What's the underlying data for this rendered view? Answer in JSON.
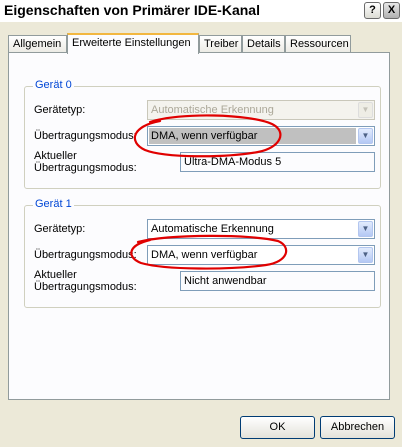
{
  "window": {
    "title": "Eigenschaften von Primärer IDE-Kanal",
    "help_label": "?",
    "close_label": "X"
  },
  "tabs": [
    {
      "label": "Allgemein"
    },
    {
      "label": "Erweiterte Einstellungen",
      "active": true
    },
    {
      "label": "Treiber"
    },
    {
      "label": "Details"
    },
    {
      "label": "Ressourcen"
    }
  ],
  "device0": {
    "legend": "Gerät 0",
    "type_label": "Gerätetyp:",
    "type_value": "Automatische Erkennung",
    "mode_label": "Übertragungsmodus:",
    "mode_value": "DMA, wenn verfügbar",
    "current_label_line1": "Aktueller",
    "current_label_line2": "Übertragungsmodus:",
    "current_value": "Ultra-DMA-Modus 5"
  },
  "device1": {
    "legend": "Gerät 1",
    "type_label": "Gerätetyp:",
    "type_value": "Automatische Erkennung",
    "mode_label": "Übertragungsmodus:",
    "mode_value": "DMA, wenn verfügbar",
    "current_label_line1": "Aktueller",
    "current_label_line2": "Übertragungsmodus:",
    "current_value": "Nicht anwendbar"
  },
  "buttons": {
    "ok": "OK",
    "cancel": "Abbrechen"
  },
  "colors": {
    "dialog_bg": "#ece9d8",
    "group_legend": "#0046d5",
    "annotation": "#e00000"
  },
  "icons": {
    "dropdown": "chevron-down-icon",
    "annotation": "red-circle-annotation"
  }
}
